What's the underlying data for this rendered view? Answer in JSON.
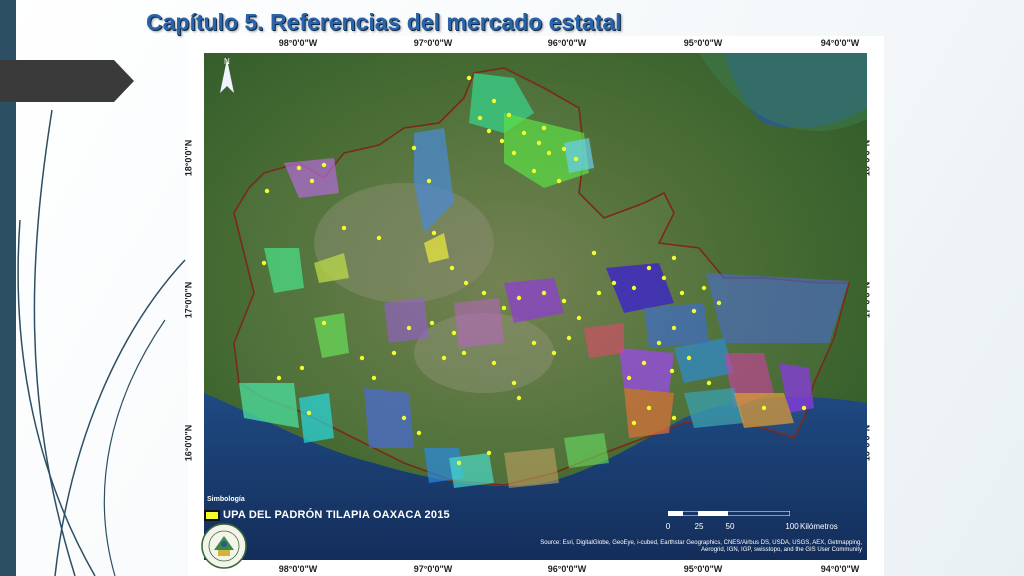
{
  "slide": {
    "title": "Capítulo 5.  Referencias del mercado estatal"
  },
  "map": {
    "lon_labels": [
      "98°0'0\"W",
      "97°0'0\"W",
      "96°0'0\"W",
      "95°0'0\"W",
      "94°0'0\"W"
    ],
    "lat_labels": [
      "18°0'0\"N",
      "17°0'0\"N",
      "16°0'0\"N"
    ],
    "north_arrow": "N",
    "legend": {
      "title": "Simbología",
      "item": "UPA DEL PADRÓN TILAPIA OAXACA 2015",
      "item_color": "#f2ff2a"
    },
    "scale": {
      "ticks": [
        "0",
        "25",
        "50",
        "100"
      ],
      "unit": "Kilómetros"
    },
    "source": "Source: Esri, DigitalGlobe, GeoEye, i-cubed, Earthstar Geographics, CNES/Airbus DS, USDA, USGS, AEX, Getmapping, Aerogrid, IGN, IGP, swisstopo, and the GIS User Community"
  },
  "colors": {
    "accent": "#2a63a8",
    "sidebar": "#2d4f63",
    "state_border": "#7a2a18",
    "sea": "#1b3e73"
  }
}
